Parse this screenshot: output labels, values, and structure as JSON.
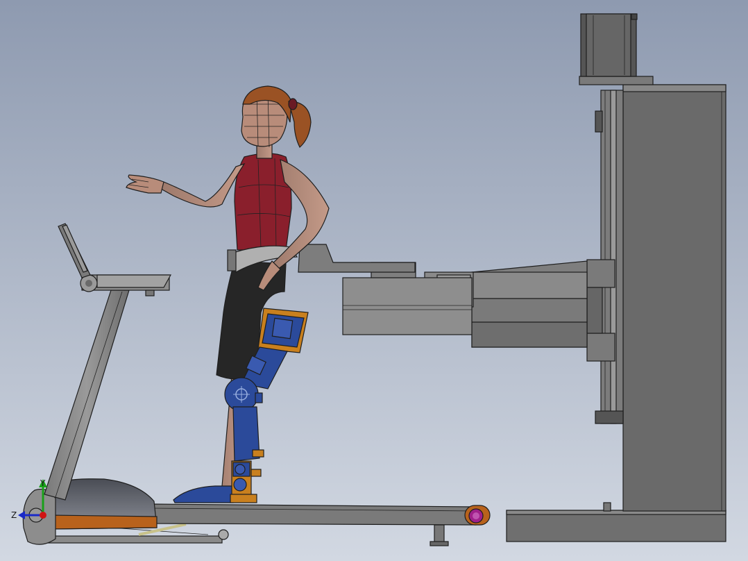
{
  "viewport": {
    "background_top": "#8e9ab0",
    "background_bottom": "#d2d8e2"
  },
  "triad": {
    "y_label": "Y",
    "z_label": "Z",
    "y_color": "#19a019",
    "z_color": "#1a2ac8",
    "x_color": "#d01414"
  },
  "colors": {
    "frame_gray": "#6b6b6b",
    "frame_light": "#8a8a8a",
    "treadmill_orange": "#b8621c",
    "exo_blue": "#2b4a9a",
    "exo_orange": "#c9801e",
    "shirt": "#8a1f2c",
    "skin": "#b08a7a",
    "hair": "#9a5224",
    "shorts": "#262626",
    "roller_magenta": "#a0208a"
  }
}
